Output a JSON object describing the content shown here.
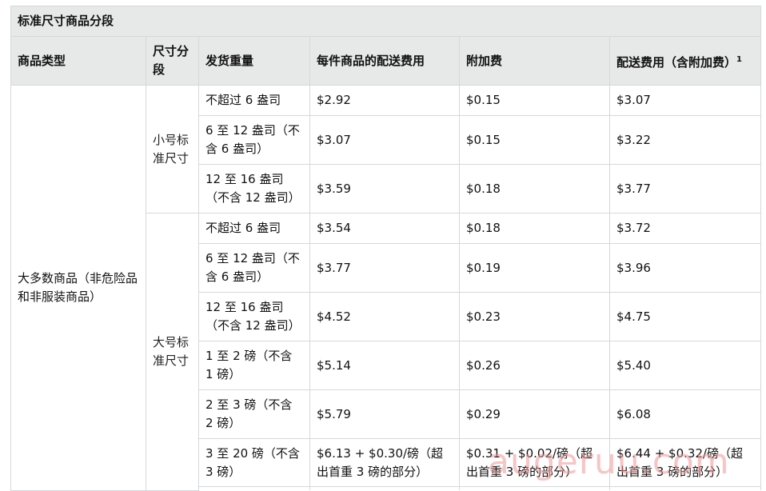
{
  "table": {
    "title": "标准尺寸商品分段",
    "headers": {
      "type": "商品类型",
      "segment": "尺寸分段",
      "weight": "发货重量",
      "fee_per_unit": "每件商品的配送费用",
      "surcharge": "附加费",
      "total": "配送费用（含附加费）",
      "total_footnote": "1"
    },
    "product_type": "大多数商品（非危险品和非服装商品）",
    "segments": {
      "small": "小号标准尺寸",
      "large": "大号标准尺寸"
    },
    "rows": [
      {
        "weight": "不超过 6 盎司",
        "fee": "$2.92",
        "surcharge": "$0.15",
        "total": "$3.07"
      },
      {
        "weight": "6 至 12 盎司（不含 6 盎司）",
        "fee": "$3.07",
        "surcharge": "$0.15",
        "total": "$3.22"
      },
      {
        "weight": "12 至 16 盎司（不含 12 盎司）",
        "fee": "$3.59",
        "surcharge": "$0.18",
        "total": "$3.77"
      },
      {
        "weight": "不超过 6 盎司",
        "fee": "$3.54",
        "surcharge": "$0.18",
        "total": "$3.72"
      },
      {
        "weight": "6 至 12 盎司（不含 6 盎司）",
        "fee": "$3.77",
        "surcharge": "$0.19",
        "total": "$3.96"
      },
      {
        "weight": "12 至 16 盎司（不含 12 盎司）",
        "fee": "$4.52",
        "surcharge": "$0.23",
        "total": "$4.75"
      },
      {
        "weight": "1 至 2 磅（不含 1 磅）",
        "fee": "$5.14",
        "surcharge": "$0.26",
        "total": "$5.40"
      },
      {
        "weight": "2 至 3 磅（不含 2 磅）",
        "fee": "$5.79",
        "surcharge": "$0.29",
        "total": "$6.08"
      },
      {
        "weight": "3 至 20 磅（不含 3 磅）",
        "fee": "$6.13 + $0.30/磅（超出首重 3 磅的部分）",
        "surcharge": "$0.31 + $0.02/磅（超出首重 3 磅的部分）",
        "total": "$6.44 + $0.32/磅（超出首重 3 磅的部分）"
      }
    ]
  },
  "watermark": "augeruu.com"
}
